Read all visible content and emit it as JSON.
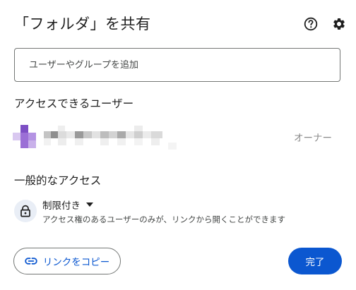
{
  "dialog": {
    "title": "「フォルダ」を共有"
  },
  "add_people": {
    "placeholder": "ユーザーやグループを追加"
  },
  "people_section": {
    "label": "アクセスできるユーザー",
    "owner": {
      "role": "オーナー"
    }
  },
  "general_access": {
    "label": "一般的なアクセス",
    "selected": "制限付き",
    "description": "アクセス権のあるユーザーのみが、リンクから開くことができます"
  },
  "footer": {
    "copy_link_label": "リンクをコピー",
    "done_label": "完了"
  },
  "icons": {
    "help": "help-icon",
    "settings": "gear-icon",
    "lock": "lock-icon",
    "link": "link-icon",
    "dropdown": "caret-down-icon"
  },
  "colors": {
    "primary": "#0b57d0",
    "avatar_purple": "#9b6fd6"
  }
}
